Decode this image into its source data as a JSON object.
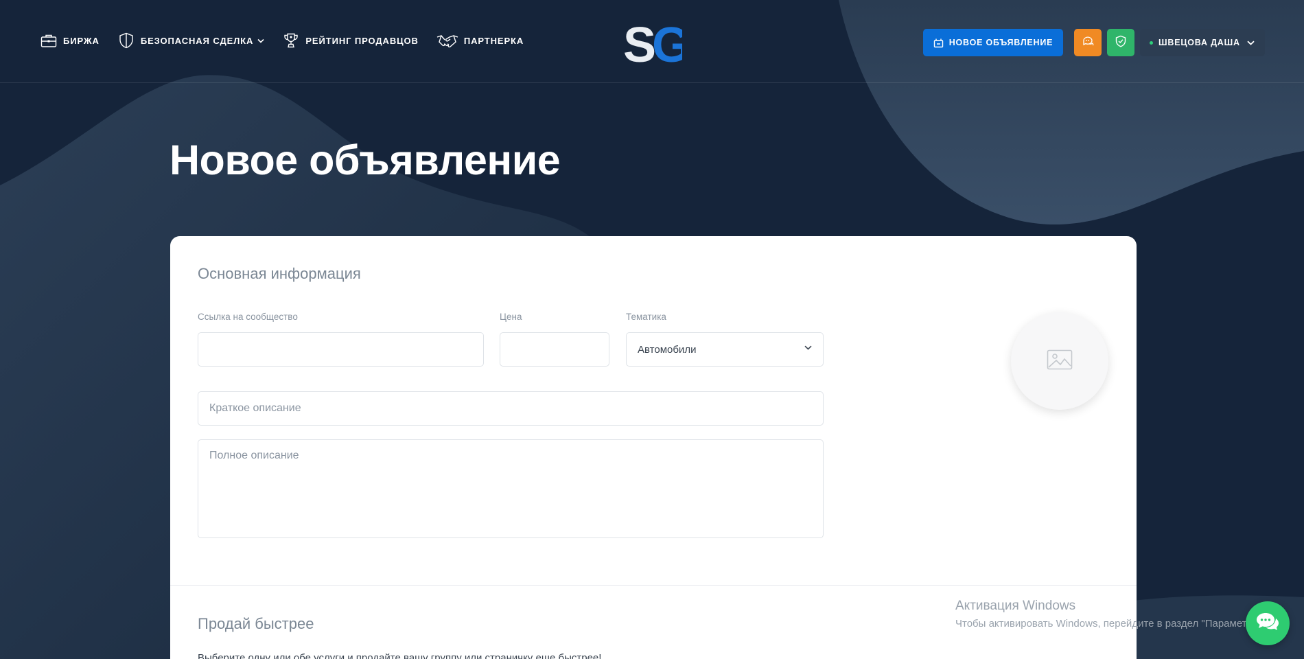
{
  "nav": {
    "items": [
      {
        "label": "БИРЖА",
        "icon": "briefcase-icon"
      },
      {
        "label": "БЕЗОПАСНАЯ СДЕЛКА",
        "icon": "shield-icon",
        "has_dropdown": true
      },
      {
        "label": "РЕЙТИНГ ПРОДАВЦОВ",
        "icon": "trophy-icon"
      },
      {
        "label": "ПАРТНЕРКА",
        "icon": "handshake-icon"
      }
    ]
  },
  "logo": {
    "text": "SG"
  },
  "header": {
    "new_ad_label": "НОВОЕ ОБЪЯВЛЕНИЕ",
    "support_icon": "support-chat-icon",
    "safety_icon": "shield-check-icon",
    "user_name": "ШВЕЦОВА ДАША",
    "user_status": "online"
  },
  "page": {
    "title": "Новое объявление"
  },
  "form": {
    "section_title": "Основная информация",
    "community_link": {
      "label": "Ссылка на сообщество",
      "value": "",
      "placeholder": ""
    },
    "price": {
      "label": "Цена",
      "value": "",
      "placeholder": ""
    },
    "topic": {
      "label": "Тематика",
      "selected": "Автомобили"
    },
    "short_description": {
      "placeholder": "Краткое описание"
    },
    "full_description": {
      "placeholder": "Полное описание"
    },
    "image_upload_icon": "image-placeholder-icon"
  },
  "promo": {
    "section_title": "Продай быстрее",
    "text": "Выберите одну или обе услуги и продайте вашу группу или страничку еще быстрее!"
  },
  "watermark": {
    "title": "Активация Windows",
    "subtitle": "Чтобы активировать Windows, перейдите в раздел \"Параметры\"."
  },
  "colors": {
    "background": "#142235",
    "primary_blue": "#0a6ed8",
    "orange": "#f08a24",
    "green": "#2fb56a",
    "chat_green": "#2ecc71",
    "user_button": "#2c3d52"
  }
}
